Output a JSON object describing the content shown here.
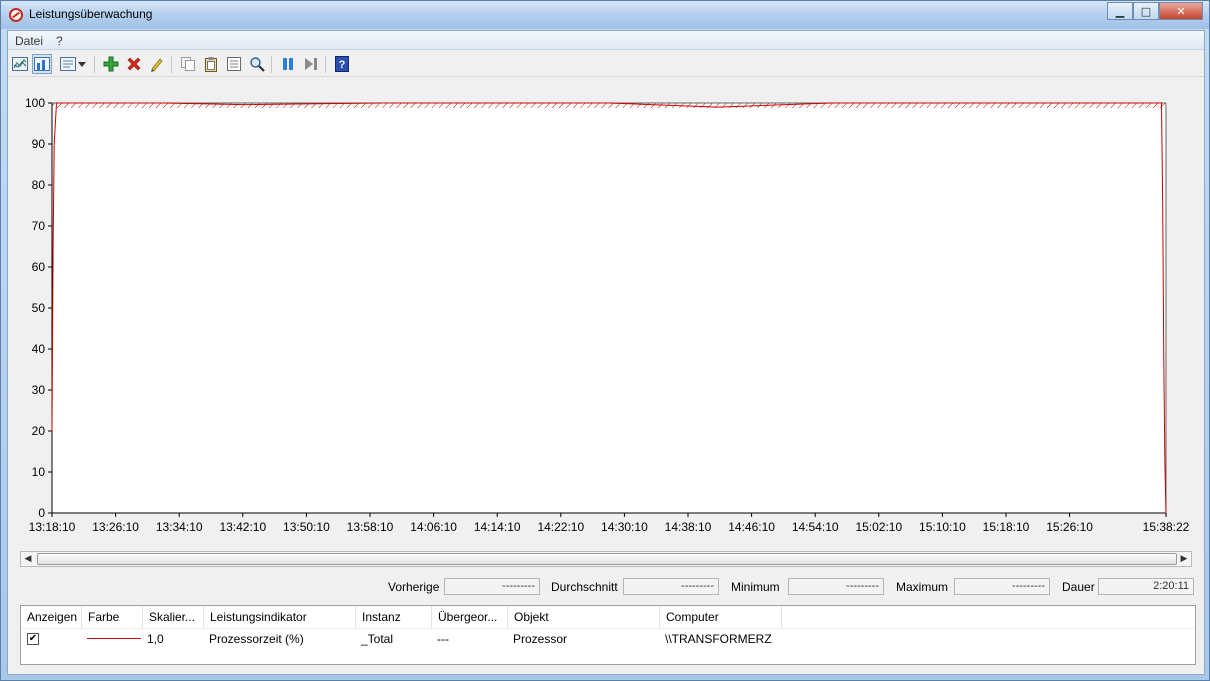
{
  "window": {
    "title": "Leistungsüberwachung",
    "buttons": {
      "minimize": "▁",
      "maximize": "□",
      "close": "✕"
    }
  },
  "menu": {
    "items": [
      "Datei",
      "?"
    ]
  },
  "toolbar": {
    "icons": [
      "view-graph-icon",
      "view-histogram-icon",
      "view-report-icon",
      "dropdown-icon",
      "add-counter-icon",
      "delete-counter-icon",
      "highlight-icon",
      "copy-properties-icon",
      "paste-counter-list-icon",
      "properties-icon",
      "zoom-icon",
      "freeze-display-icon",
      "update-data-icon",
      "help-icon"
    ]
  },
  "chart_data": {
    "type": "line",
    "title": "",
    "xlabel": "",
    "ylabel": "",
    "ylim": [
      0,
      100
    ],
    "y_ticks": [
      "100",
      "90",
      "80",
      "70",
      "60",
      "50",
      "40",
      "30",
      "20",
      "10",
      "0"
    ],
    "x_ticks": [
      "13:18:10",
      "13:26:10",
      "13:34:10",
      "13:42:10",
      "13:50:10",
      "13:58:10",
      "14:06:10",
      "14:14:10",
      "14:22:10",
      "14:30:10",
      "14:38:10",
      "14:46:10",
      "14:54:10",
      "15:02:10",
      "15:10:10",
      "15:18:10",
      "15:26:10",
      "15:38:22"
    ],
    "grid": false,
    "series": [
      {
        "name": "Prozessorzeit (%)",
        "color": "#cc0000",
        "points": [
          {
            "t": 0.0,
            "y": 20
          },
          {
            "t": 0.001,
            "y": 65
          },
          {
            "t": 0.002,
            "y": 90
          },
          {
            "t": 0.004,
            "y": 100
          },
          {
            "t": 0.1,
            "y": 100
          },
          {
            "t": 0.172,
            "y": 99.6
          },
          {
            "t": 0.3,
            "y": 100
          },
          {
            "t": 0.5,
            "y": 100
          },
          {
            "t": 0.597,
            "y": 99
          },
          {
            "t": 0.7,
            "y": 100
          },
          {
            "t": 0.9,
            "y": 100
          },
          {
            "t": 0.996,
            "y": 100
          },
          {
            "t": 0.997,
            "y": 75
          },
          {
            "t": 0.998,
            "y": 37
          },
          {
            "t": 0.999,
            "y": 12
          },
          {
            "t": 1.0,
            "y": 0
          }
        ]
      }
    ]
  },
  "stats": {
    "previous_label": "Vorherige",
    "previous_value": "---------",
    "average_label": "Durchschnitt",
    "average_value": "---------",
    "minimum_label": "Minimum",
    "minimum_value": "---------",
    "maximum_label": "Maximum",
    "maximum_value": "---------",
    "duration_label": "Dauer",
    "duration_value": "2:20:11"
  },
  "legend": {
    "columns": [
      "Anzeigen",
      "Farbe",
      "Skalier...",
      "Leistungsindikator",
      "Instanz",
      "Übergeor...",
      "Objekt",
      "Computer"
    ],
    "rows": [
      {
        "show": "✔",
        "color": "#cc0000",
        "scale": "1,0",
        "counter": "Prozessorzeit (%)",
        "instance": "_Total",
        "parent": "---",
        "object": "Prozessor",
        "computer": "\\\\TRANSFORMERZ"
      }
    ]
  }
}
